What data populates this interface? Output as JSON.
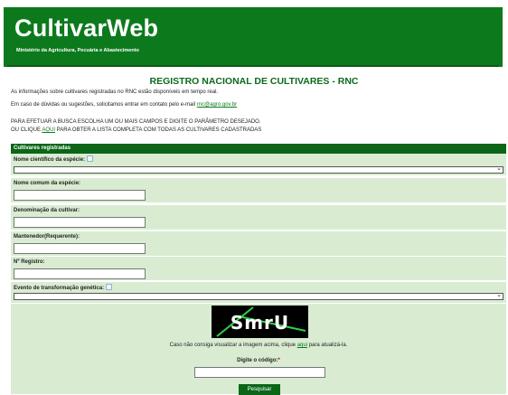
{
  "header": {
    "title": "CultivarWeb",
    "subtitle": "Ministério da Agricultura, Pecuária e Abastecimento"
  },
  "page_title": "REGISTRO NACIONAL DE CULTIVARES - RNC",
  "intro": {
    "line1": "As informações sobre cultivares registradas no RNC estão disponíveis em tempo real.",
    "line2_prefix": "Em caso de dúvidas ou sugestões, solicitamos entrar em contato pelo e-mail ",
    "email": "rnc@agro.gov.br",
    "line3": "PARA EFETUAR A BUSCA ESCOLHA UM OU MAIS CAMPOS E DIGITE O PARÂMETRO DESEJADO.",
    "line4_prefix": "OU CLIQUE ",
    "line4_link": "AQUI",
    "line4_suffix": " PARA OBTER A LISTA COMPLETA COM TODAS AS CULTIVARES CADASTRADAS"
  },
  "section_title": "Cultivares registradas",
  "fields": {
    "species_scientific": "Nome científico da espécie:",
    "species_common": "Nome comum da espécie:",
    "cultivar_name": "Denominação da cultivar:",
    "maintainer": "Mantenedor(Requerente):",
    "registration_no": "Nº Registro:",
    "transformation_event": "Evento de transformação genética:"
  },
  "captcha": {
    "text": "SmrU",
    "caption_prefix": "Caso não consiga visualizar a imagem acima, clique ",
    "caption_link": "aqui",
    "caption_suffix": " para atualizá-la.",
    "code_label": "Digite o código:",
    "required_mark": "*"
  },
  "search_button": "Pesquisar",
  "colors": {
    "header_green": "#0c7a1c",
    "bar_green": "#0b6618",
    "field_bg": "#d9ecd2"
  }
}
